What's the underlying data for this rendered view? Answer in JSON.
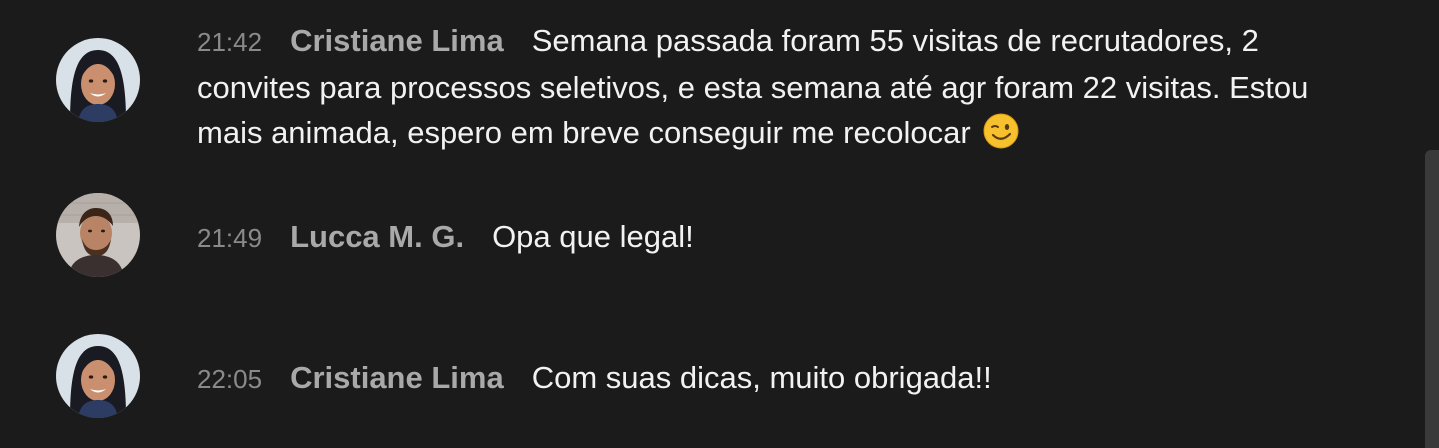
{
  "messages": [
    {
      "time": "21:42",
      "author": "Cristiane Lima",
      "text": "Semana passada foram 55 visitas de recrutadores, 2 convites para processos seletivos, e esta semana até agr foram 22 visitas. Estou mais animada, espero em breve conseguir me recolocar",
      "emoji": "winking-face-icon",
      "avatar": "avatar-cristiane"
    },
    {
      "time": "21:49",
      "author": "Lucca M. G.",
      "text": "Opa que legal!",
      "avatar": "avatar-lucca"
    },
    {
      "time": "22:05",
      "author": "Cristiane Lima",
      "text": "Com suas dicas, muito obrigada!!",
      "avatar": "avatar-cristiane"
    }
  ],
  "colors": {
    "background": "#1b1b1b",
    "message_text": "#f2f2f2",
    "author": "#a9a9a9",
    "time": "#8a8a8a",
    "scrollbar": "#3a3a3a"
  }
}
